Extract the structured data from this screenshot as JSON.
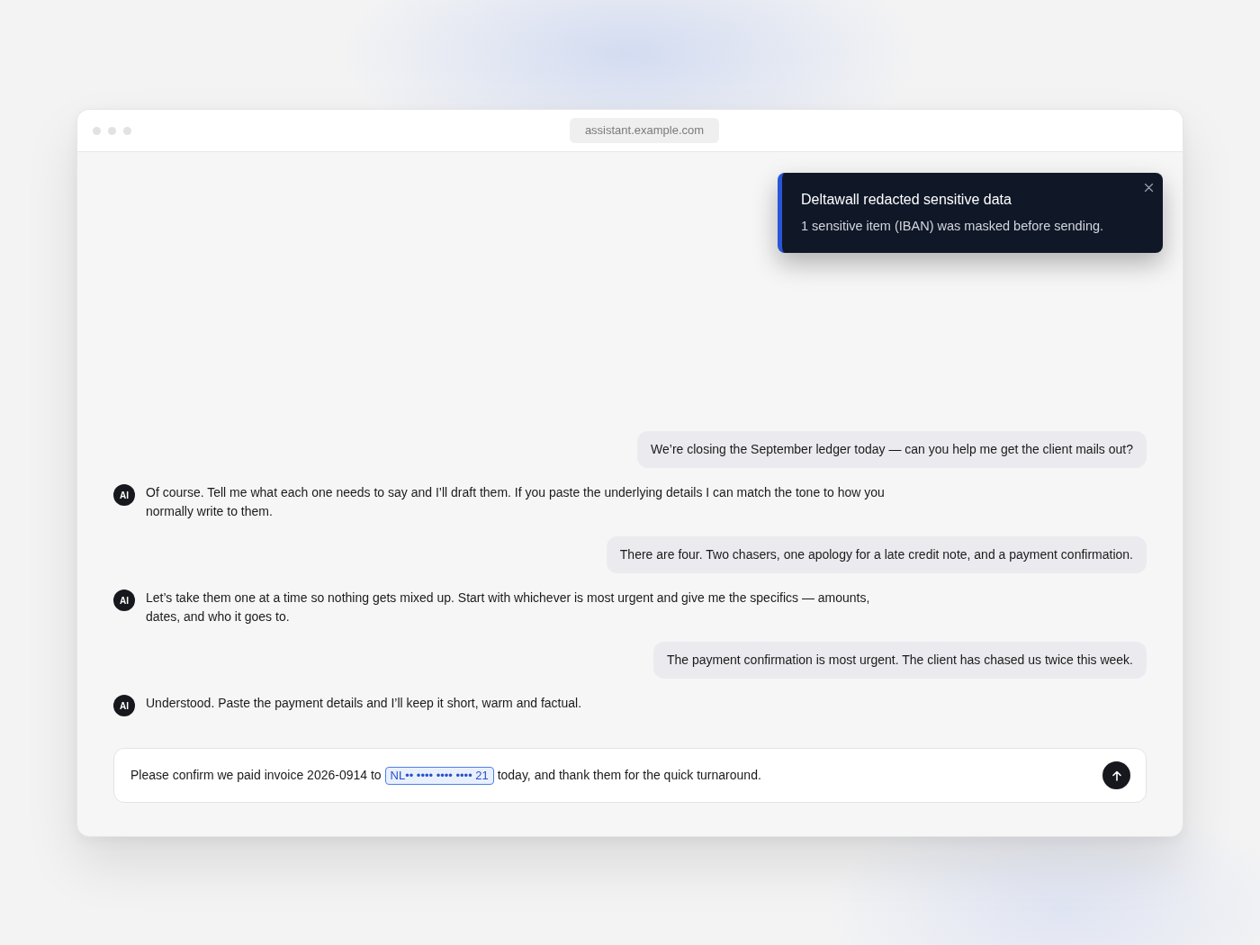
{
  "browser": {
    "url": "assistant.example.com"
  },
  "toast": {
    "title": "Deltawall redacted sensitive data",
    "message": "1 sensitive item (IBAN) was masked before sending."
  },
  "messages": [
    {
      "kind": "user",
      "text": "We’re closing the September ledger today — can you help me get the client mails out?"
    },
    {
      "kind": "assistant",
      "avatar": "AI",
      "text": "Of course. Tell me what each one needs to say and I’ll draft them. If you paste the underlying details I can match the tone to how you normally write to them."
    },
    {
      "kind": "user",
      "text": "There are four. Two chasers, one apology for a late credit note, and a payment confirmation."
    },
    {
      "kind": "assistant",
      "avatar": "AI",
      "text": "Let’s take them one at a time so nothing gets mixed up. Start with whichever is most urgent and give me the specifics — amounts, dates, and who it goes to."
    },
    {
      "kind": "user",
      "text": "The payment confirmation is most urgent. The client has chased us twice this week."
    },
    {
      "kind": "assistant",
      "avatar": "AI",
      "text": "Understood. Paste the payment details and I’ll keep it short, warm and factual."
    }
  ],
  "composer": {
    "segments": [
      {
        "kind": "text",
        "text": "Please confirm we paid invoice 2026-0914 to"
      },
      {
        "kind": "redacted",
        "text": "NL•• •••• •••• •••• 21"
      },
      {
        "kind": "text",
        "text": "today, and thank them for the quick turnaround."
      }
    ]
  }
}
